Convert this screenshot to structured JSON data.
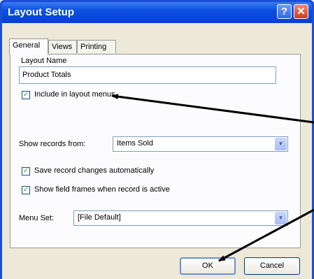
{
  "window": {
    "title": "Layout Setup",
    "help_glyph": "?",
    "close_glyph": "✕",
    "colors": {
      "titlebar": "#0a4fe0",
      "face": "#ece9d8",
      "close": "#d4391c"
    }
  },
  "tabs": [
    {
      "label": "General",
      "active": true
    },
    {
      "label": "Views",
      "active": false
    },
    {
      "label": "Printing",
      "active": false
    }
  ],
  "layout_name": {
    "label": "Layout Name",
    "value": "Product Totals"
  },
  "include_in_menus": {
    "label": "Include in layout menus",
    "checked": true
  },
  "show_records": {
    "label": "Show records from:",
    "value": "Items Sold"
  },
  "save_changes": {
    "label": "Save record changes automatically",
    "checked": true
  },
  "show_frames": {
    "label": "Show field frames when record is active",
    "checked": true
  },
  "menu_set": {
    "label": "Menu Set:",
    "value": "[File Default]"
  },
  "buttons": {
    "ok": "OK",
    "cancel": "Cancel"
  },
  "check_glyph": "✓",
  "arrow_glyph": "▼"
}
